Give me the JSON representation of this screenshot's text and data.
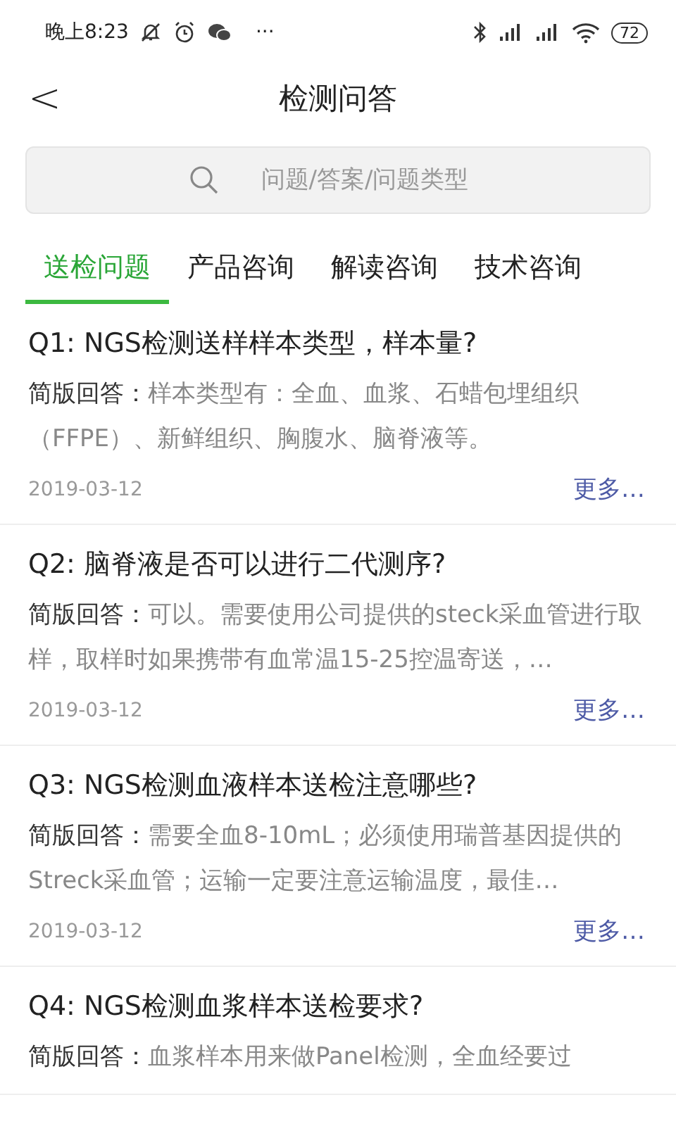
{
  "status_bar": {
    "time": "晚上8:23",
    "more": "···",
    "battery": "72"
  },
  "header": {
    "back": "<",
    "title": "检测问答"
  },
  "search": {
    "placeholder": "问题/答案/问题类型"
  },
  "tabs": [
    {
      "label": "送检问题",
      "selected": true
    },
    {
      "label": "产品咨询",
      "selected": false
    },
    {
      "label": "解读咨询",
      "selected": false
    },
    {
      "label": "技术咨询",
      "selected": false
    }
  ],
  "questions": [
    {
      "title": "Q1: NGS检测送样样本类型，样本量?",
      "label": "简版回答：",
      "answer": "样本类型有：全血、血浆、石蜡包埋组织（FFPE）、新鲜组织、胸腹水、脑脊液等。",
      "date": "2019-03-12",
      "more": "更多…"
    },
    {
      "title": "Q2: 脑脊液是否可以进行二代测序?",
      "label": "简版回答：",
      "answer": "可以。需要使用公司提供的steck采血管进行取样，取样时如果携带有血常温15-25控温寄送，…",
      "date": "2019-03-12",
      "more": "更多…"
    },
    {
      "title": "Q3: NGS检测血液样本送检注意哪些?",
      "label": "简版回答：",
      "answer": "需要全血8-10mL；必须使用瑞普基因提供的Streck采血管；运输一定要注意运输温度，最佳…",
      "date": "2019-03-12",
      "more": "更多…"
    },
    {
      "title": "Q4: NGS检测血浆样本送检要求?",
      "label": "简版回答：",
      "answer": "血浆样本用来做Panel检测，全血经要过"
    }
  ]
}
